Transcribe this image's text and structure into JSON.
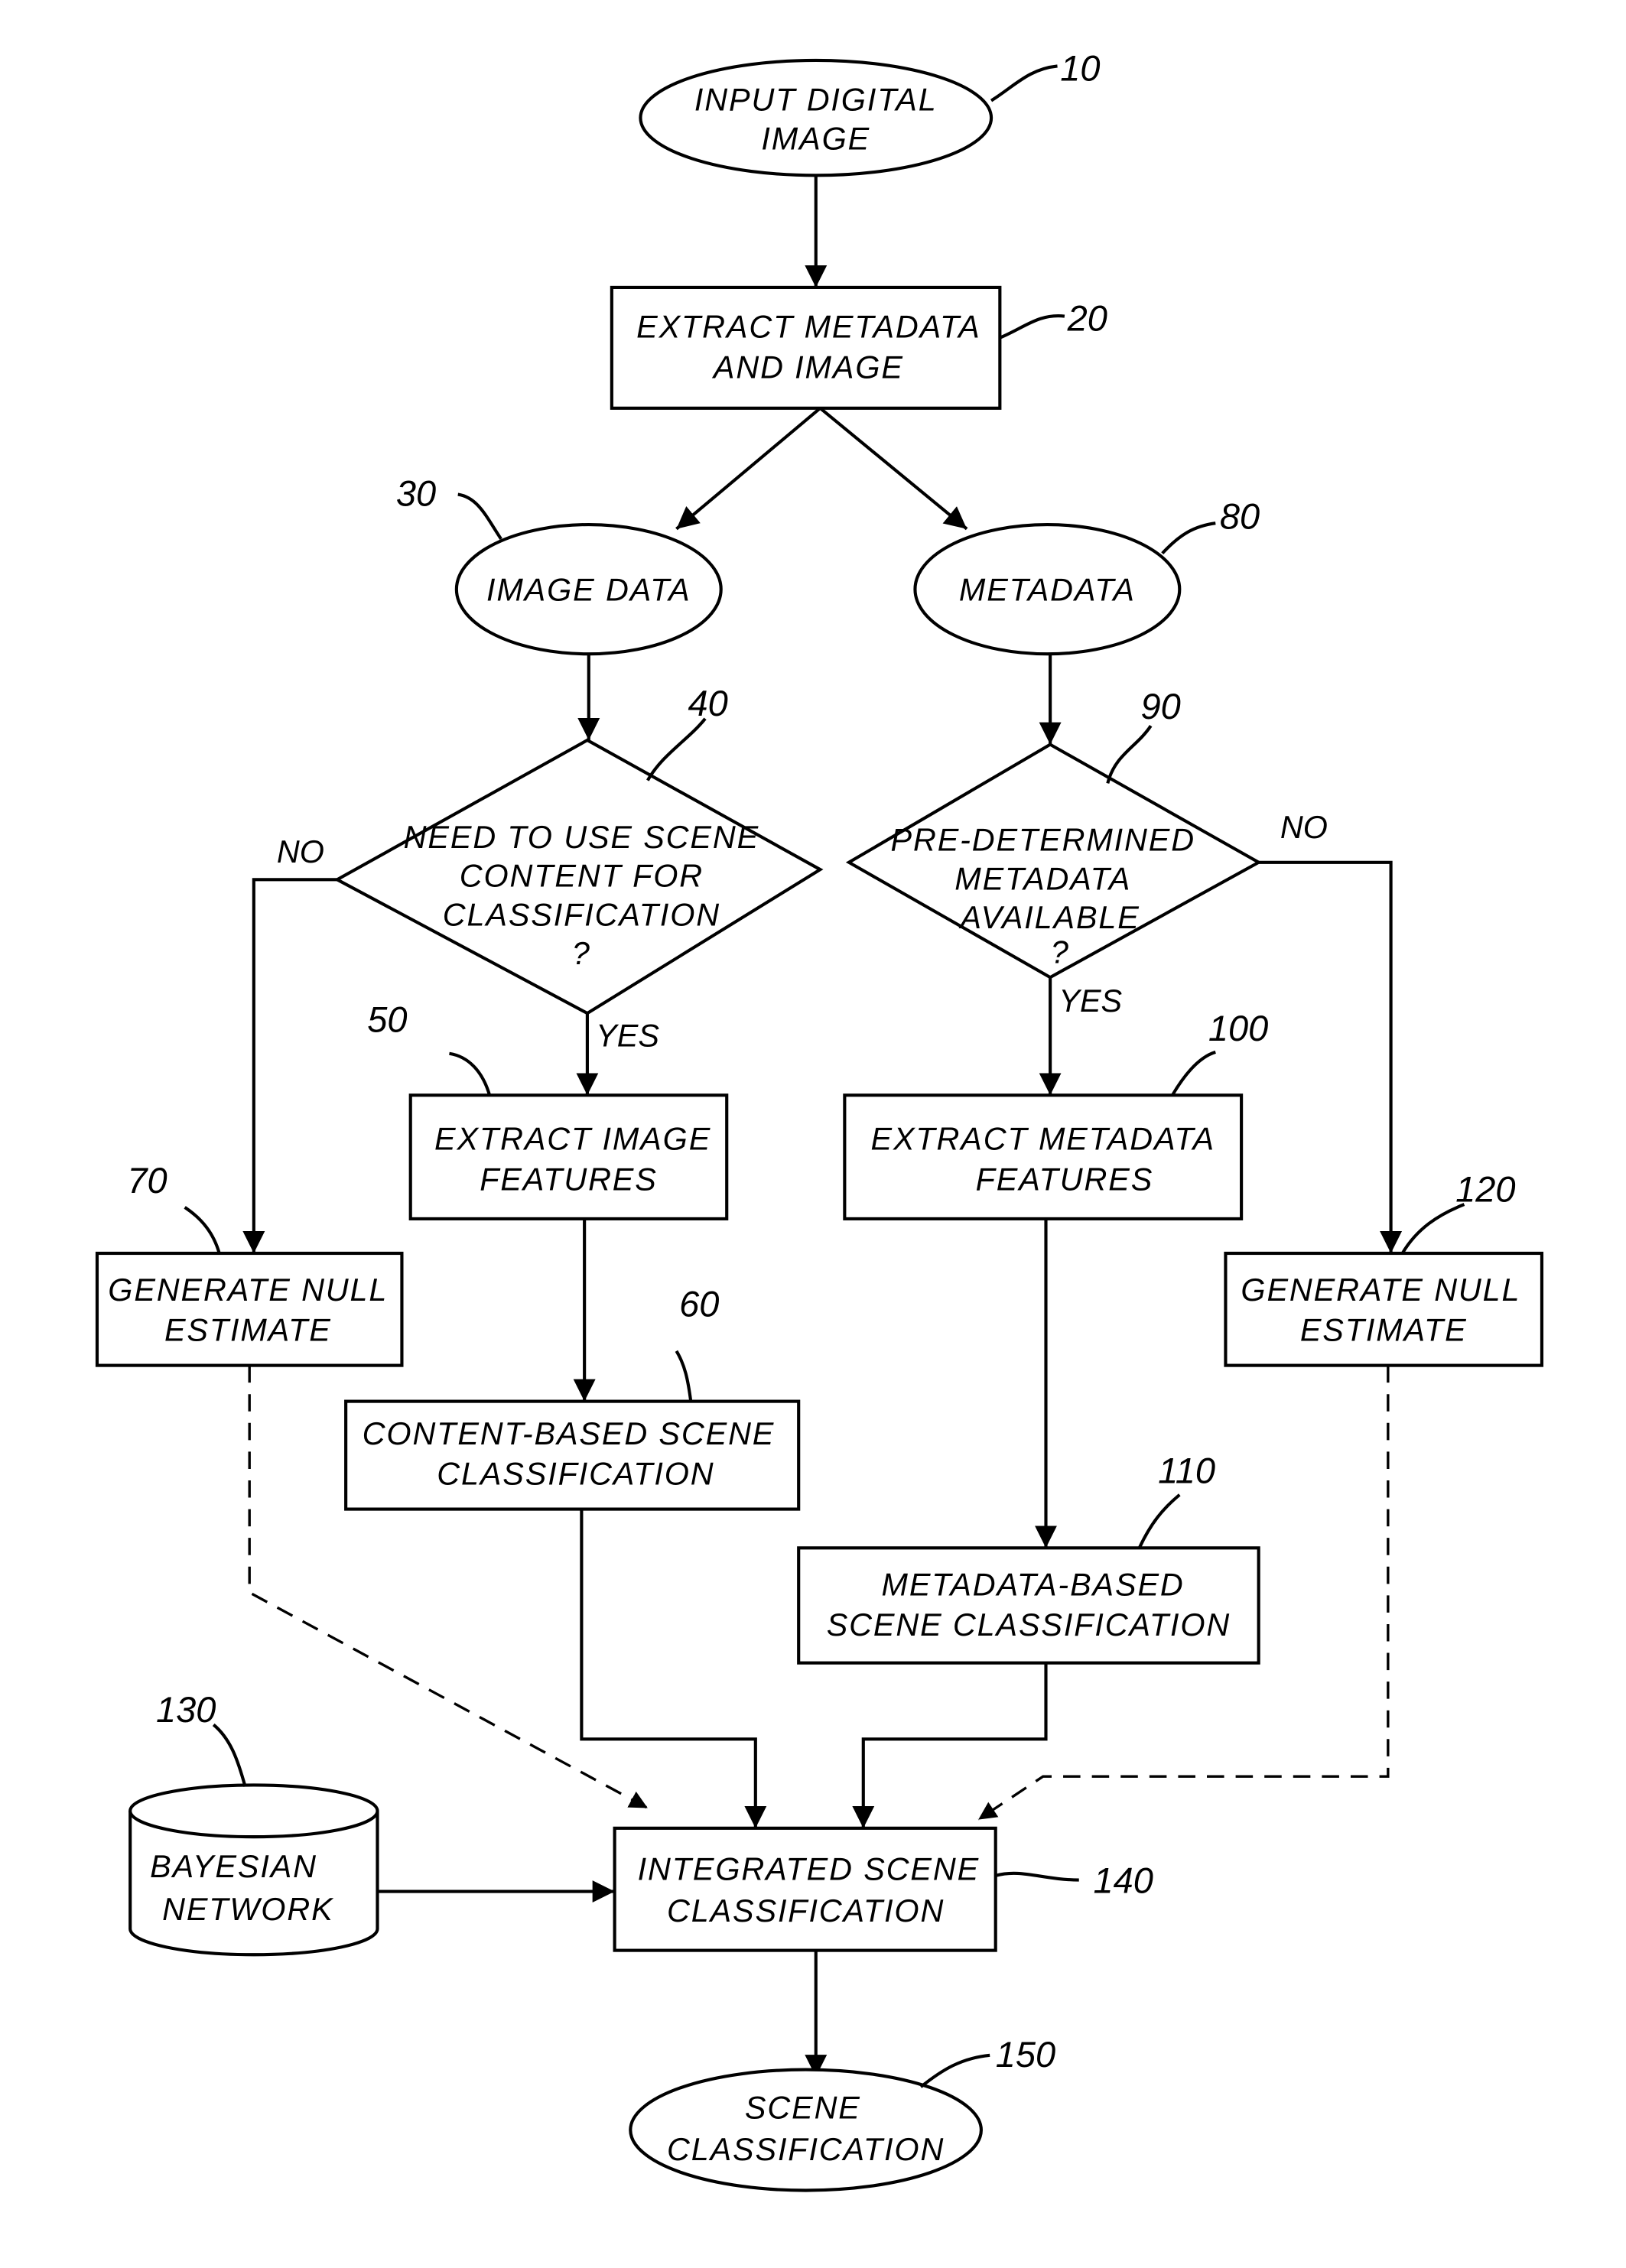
{
  "diagram": {
    "nodes": {
      "n10": {
        "ref": "10",
        "lines": [
          "INPUT DIGITAL",
          "IMAGE"
        ]
      },
      "n20": {
        "ref": "20",
        "lines": [
          "EXTRACT METADATA",
          "AND IMAGE"
        ]
      },
      "n30": {
        "ref": "30",
        "lines": [
          "IMAGE DATA"
        ]
      },
      "n80": {
        "ref": "80",
        "lines": [
          "METADATA"
        ]
      },
      "n40": {
        "ref": "40",
        "lines": [
          "NEED TO USE SCENE",
          "CONTENT FOR",
          "CLASSIFICATION",
          "?"
        ]
      },
      "n90": {
        "ref": "90",
        "lines": [
          "PRE-DETERMINED",
          "METADATA",
          "AVAILABLE",
          "?"
        ]
      },
      "n50": {
        "ref": "50",
        "lines": [
          "EXTRACT IMAGE",
          "FEATURES"
        ]
      },
      "n100": {
        "ref": "100",
        "lines": [
          "EXTRACT METADATA",
          "FEATURES"
        ]
      },
      "n70": {
        "ref": "70",
        "lines": [
          "GENERATE NULL",
          "ESTIMATE"
        ]
      },
      "n120": {
        "ref": "120",
        "lines": [
          "GENERATE NULL",
          "ESTIMATE"
        ]
      },
      "n60": {
        "ref": "60",
        "lines": [
          "CONTENT-BASED SCENE",
          "CLASSIFICATION"
        ]
      },
      "n110": {
        "ref": "110",
        "lines": [
          "METADATA-BASED",
          "SCENE CLASSIFICATION"
        ]
      },
      "n130": {
        "ref": "130",
        "lines": [
          "BAYESIAN",
          "NETWORK"
        ]
      },
      "n140": {
        "ref": "140",
        "lines": [
          "INTEGRATED SCENE",
          "CLASSIFICATION"
        ]
      },
      "n150": {
        "ref": "150",
        "lines": [
          "SCENE",
          "CLASSIFICATION"
        ]
      }
    },
    "branch_labels": {
      "d40_no": "NO",
      "d40_yes": "YES",
      "d90_no": "NO",
      "d90_yes": "YES"
    }
  }
}
